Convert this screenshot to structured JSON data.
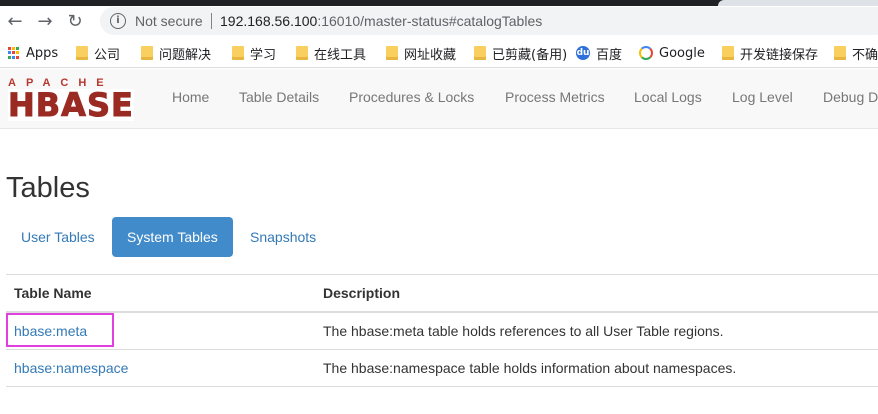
{
  "browser": {
    "security_label": "Not secure",
    "url_host": "192.168.56.100",
    "url_rest": ":16010/master-status#catalogTables"
  },
  "bookmarks": [
    {
      "label": "Apps",
      "icon": "apps-grid-icon"
    },
    {
      "label": "公司",
      "icon": "folder-icon"
    },
    {
      "label": "问题解决",
      "icon": "folder-icon"
    },
    {
      "label": "学习",
      "icon": "folder-icon"
    },
    {
      "label": "在线工具",
      "icon": "folder-icon"
    },
    {
      "label": "网址收藏",
      "icon": "folder-icon"
    },
    {
      "label": "已剪藏(备用)",
      "icon": "folder-icon"
    },
    {
      "label": "百度",
      "icon": "baidu-icon"
    },
    {
      "label": "Google",
      "icon": "google-icon"
    },
    {
      "label": "开发链接保存",
      "icon": "folder-icon"
    },
    {
      "label": "不确",
      "icon": "folder-icon"
    }
  ],
  "logo": {
    "top": "APACHE",
    "main": "HBASE"
  },
  "nav": {
    "home": "Home",
    "table_details": "Table Details",
    "procedures": "Procedures & Locks",
    "process_metrics": "Process Metrics",
    "local_logs": "Local Logs",
    "log_level": "Log Level",
    "debug": "Debug D"
  },
  "page": {
    "title": "Tables"
  },
  "tabs": {
    "user": "User Tables",
    "system": "System Tables",
    "snapshots": "Snapshots"
  },
  "table": {
    "headers": {
      "name": "Table Name",
      "description": "Description"
    },
    "rows": [
      {
        "name": "hbase:meta",
        "description": "The hbase:meta table holds references to all User Table regions."
      },
      {
        "name": "hbase:namespace",
        "description": "The hbase:namespace table holds information about namespaces."
      }
    ]
  },
  "colors": {
    "link": "#337ab7",
    "active_tab": "#428bca",
    "highlight": "#e23fe0",
    "logo": "#9a2b23"
  }
}
